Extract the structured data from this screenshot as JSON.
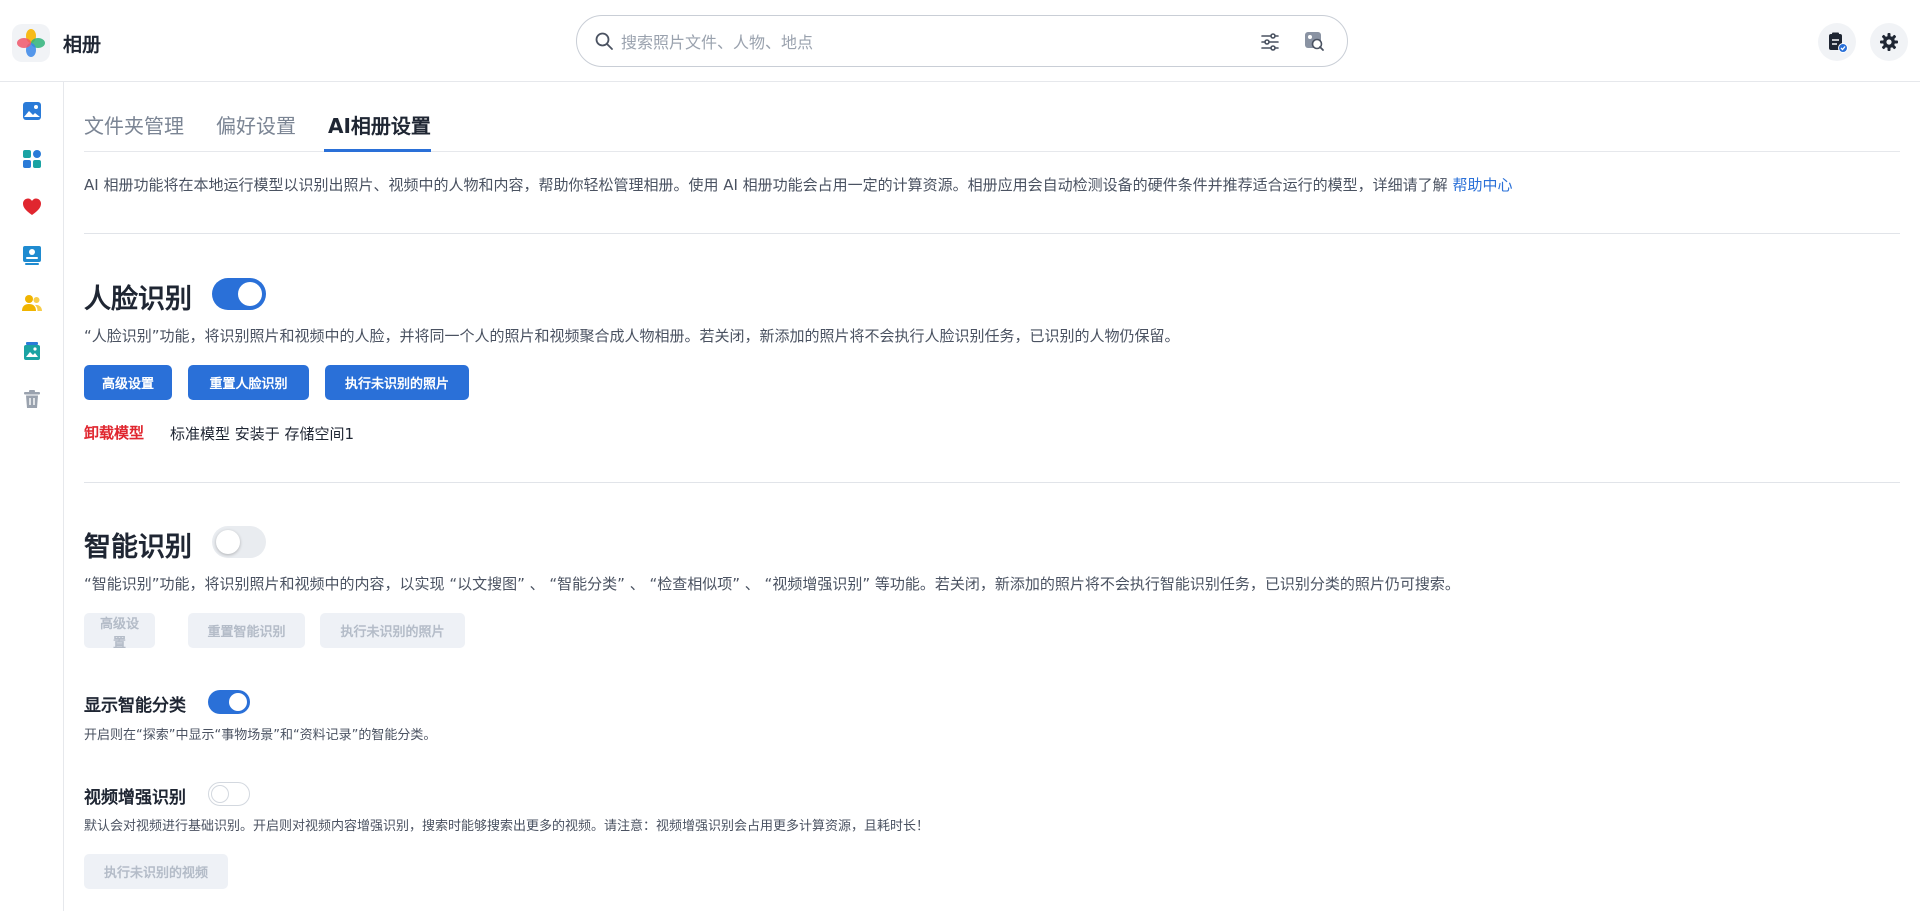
{
  "app": {
    "title": "相册"
  },
  "search": {
    "placeholder": "搜索照片文件、人物、地点",
    "value": "",
    "icons": [
      "search-icon",
      "filter-icon",
      "image-search-icon"
    ]
  },
  "header_buttons": [
    "task-list-icon",
    "settings-icon"
  ],
  "sidebar": {
    "items": [
      {
        "name": "photos",
        "icon": "image-icon",
        "color": "#2a7bd8"
      },
      {
        "name": "albums",
        "icon": "grid-icon",
        "color": "#1aa3a3"
      },
      {
        "name": "favorites",
        "icon": "heart-icon",
        "color": "#e0262f"
      },
      {
        "name": "recognition",
        "icon": "face-card-icon",
        "color": "#1f8bd0"
      },
      {
        "name": "people",
        "icon": "people-icon",
        "color": "#f0b400"
      },
      {
        "name": "shared",
        "icon": "shared-album-icon",
        "color": "#1aa3a3"
      },
      {
        "name": "trash",
        "icon": "trash-icon",
        "color": "#9aa2ae"
      }
    ]
  },
  "tabs": [
    {
      "label": "文件夹管理",
      "active": false
    },
    {
      "label": "偏好设置",
      "active": false
    },
    {
      "label": "AI相册设置",
      "active": true
    }
  ],
  "intro": {
    "text": "AI 相册功能将在本地运行模型以识别出照片、视频中的人物和内容，帮助你轻松管理相册。使用 AI 相册功能会占用一定的计算资源。相册应用会自动检测设备的硬件条件并推荐适合运行的模型，详细请了解",
    "link": "帮助中心"
  },
  "face": {
    "title": "人脸识别",
    "enabled": true,
    "description": "“人脸识别”功能，将识别照片和视频中的人脸，并将同一个人的照片和视频聚合成人物相册。若关闭，新添加的照片将不会执行人脸识别任务，已识别的人物仍保留。",
    "buttons": {
      "advanced": "高级设置",
      "reset": "重置人脸识别",
      "run": "执行未识别的照片"
    },
    "unload_label": "卸载模型",
    "model_info": "标准模型 安装于 存储空间1"
  },
  "smart": {
    "title": "智能识别",
    "enabled": false,
    "description": "“智能识别”功能，将识别照片和视频中的内容，以实现 “以文搜图” 、 “智能分类” 、 “检查相似项” 、 “视频增强识别” 等功能。若关闭，新添加的照片将不会执行智能识别任务，已识别分类的照片仍可搜索。",
    "buttons": {
      "advanced": "高级设置",
      "reset": "重置智能识别",
      "run": "执行未识别的照片"
    }
  },
  "show_category": {
    "title": "显示智能分类",
    "enabled": true,
    "description": "开启则在“探索”中显示“事物场景”和“资料记录”的智能分类。"
  },
  "video_enhance": {
    "title": "视频增强识别",
    "enabled": false,
    "description": "默认会对视频进行基础识别。开启则对视频内容增强识别，搜索时能够搜索出更多的视频。请注意：视频增强识别会占用更多计算资源，且耗时长！",
    "button": "执行未识别的视频"
  },
  "colors": {
    "accent": "#2a70d8",
    "danger": "#e0262f",
    "disabled_bg": "#eef1f6",
    "disabled_text": "#b4bcc8"
  }
}
